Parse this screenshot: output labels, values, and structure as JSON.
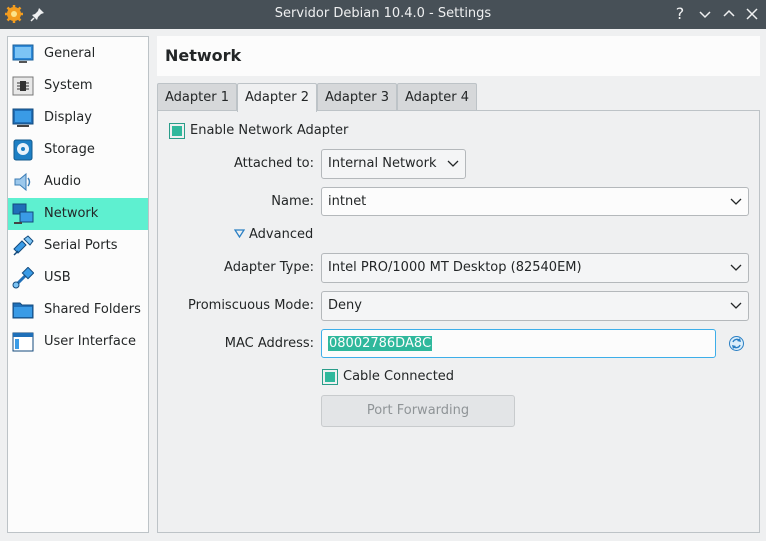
{
  "window": {
    "title": "Servidor Debian 10.4.0 - Settings",
    "help_symbol": "?"
  },
  "sidebar": {
    "items": [
      {
        "label": "General",
        "icon": "general-icon"
      },
      {
        "label": "System",
        "icon": "chip-icon"
      },
      {
        "label": "Display",
        "icon": "monitor-icon"
      },
      {
        "label": "Storage",
        "icon": "disk-icon"
      },
      {
        "label": "Audio",
        "icon": "speaker-icon"
      },
      {
        "label": "Network",
        "icon": "network-icon",
        "selected": true
      },
      {
        "label": "Serial Ports",
        "icon": "serial-port-icon"
      },
      {
        "label": "USB",
        "icon": "usb-icon"
      },
      {
        "label": "Shared Folders",
        "icon": "folder-icon"
      },
      {
        "label": "User Interface",
        "icon": "window-icon"
      }
    ]
  },
  "page": {
    "title": "Network"
  },
  "tabs": [
    {
      "label": "Adapter 1"
    },
    {
      "label": "Adapter 2",
      "active": true
    },
    {
      "label": "Adapter 3"
    },
    {
      "label": "Adapter 4"
    }
  ],
  "adapter": {
    "enable_label": "Enable Network Adapter",
    "enabled": true,
    "attached_label": "Attached to:",
    "attached_value": "Internal Network",
    "name_label": "Name:",
    "name_value": "intnet",
    "advanced_label": "Advanced",
    "adapter_type_label": "Adapter Type:",
    "adapter_type_value": "Intel PRO/1000 MT Desktop (82540EM)",
    "promiscuous_label": "Promiscuous Mode:",
    "promiscuous_value": "Deny",
    "mac_label": "MAC Address:",
    "mac_value": "08002786DA8C",
    "cable_label": "Cable Connected",
    "cable_connected": true,
    "port_forwarding_label": "Port Forwarding"
  },
  "colors": {
    "titlebar": "#475057",
    "selection": "#5ef0d0",
    "accent": "#2fb89c"
  }
}
